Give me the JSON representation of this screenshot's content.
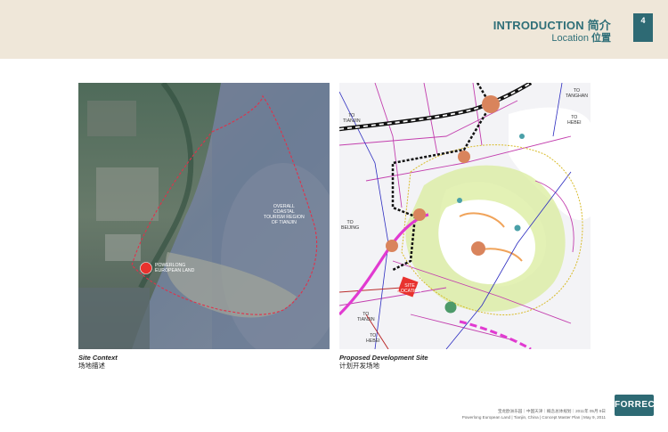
{
  "header": {
    "title_en": "INTRODUCTION",
    "title_cn": "简介",
    "subtitle_en": "Location",
    "subtitle_cn": "位置",
    "page_number": "4",
    "colors": {
      "band": "#efe7d9",
      "accent": "#2f6f78",
      "page_box": "#2e6a74"
    }
  },
  "left_panel": {
    "caption_en": "Site Context",
    "caption_cn": "场地描述",
    "labels": {
      "region": [
        "OVERALL",
        "COASTAL",
        "TOURISM REGION",
        "OF TIANJIN"
      ],
      "site": [
        "POWERLONG",
        "EUROPEAN LAND"
      ]
    }
  },
  "right_panel": {
    "caption_en": "Proposed Development Site",
    "caption_cn": "计划开发场地",
    "labels": {
      "to_tianjin_top": [
        "TO",
        "TIANJIN"
      ],
      "to_tanghan": [
        "TO",
        "TANGHAN"
      ],
      "to_hebei_top": [
        "TO",
        "HEBEI"
      ],
      "to_beijing": [
        "TO",
        "BEIJING"
      ],
      "to_tianjin_bottom": [
        "TO",
        "TIANJIN"
      ],
      "to_hebei_bottom": [
        "TO",
        "HEBEI"
      ],
      "site": [
        "SITE",
        "LOCATION"
      ]
    }
  },
  "footer": {
    "line1": "宝龙欧洲乐园｜中国天津｜概念总体规划｜2011年 05月 9日",
    "line2": "Powerlong European Land  |  Tianjin, China  |  Concept Master Plan  |  May 9, 2011"
  },
  "logo": {
    "text": "FORREC"
  }
}
